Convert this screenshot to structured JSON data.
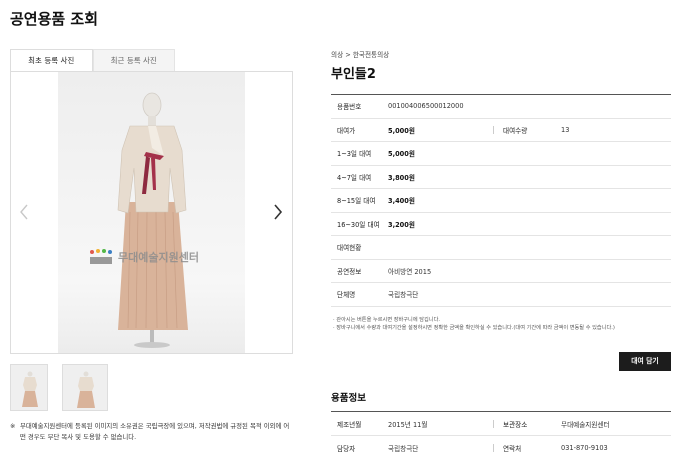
{
  "page": {
    "title": "공연용품 조회"
  },
  "gallery": {
    "tabs": [
      {
        "label": "최초 등록 사진"
      },
      {
        "label": "최근 등록 사진"
      }
    ],
    "watermark": "무대예술지원센터",
    "copyright": "무대예술지원센터에 등록된 이미지의 소유권은 국립극장에 있으며, 저작권법에 규정된 목적 이외에 어떤 경우도 무단 복사 및 도용할 수 없습니다.",
    "copyright_mark": "※",
    "colors": {
      "jeogori": "#e7dccf",
      "chima": "#d9b39a",
      "goreum": "#a4314a"
    }
  },
  "item": {
    "breadcrumb": "의상 > 한국전통의상",
    "title": "부인들2",
    "product_no_label": "용품번호",
    "product_no": "001004006500012000",
    "rent_price_label": "대여가",
    "rent_price": "5,000원",
    "rent_qty_label": "대여수량",
    "rent_qty": "13",
    "periods": [
      {
        "label": "1~3일 대여",
        "price": "5,000원"
      },
      {
        "label": "4~7일 대여",
        "price": "3,800원"
      },
      {
        "label": "8~15일 대여",
        "price": "3,400원"
      },
      {
        "label": "16~30일 대여",
        "price": "3,200원"
      }
    ],
    "status_label": "대여현황",
    "performance_label": "공연정보",
    "performance": "아비방연 2015",
    "group_label": "단체명",
    "group": "국립창극단",
    "notes": [
      "· 관아시는 버튼을 누르시면 장바구니에 담깁니다.",
      "· 장바구니에서 수량과 대여기간을 설정하시면 정확한 금액을 확인하실 수 있습니다.(대여 기간에 따라 금액이 변동될 수 있습니다.)"
    ],
    "rent_button": "대여 담기"
  },
  "spec": {
    "title": "용품정보",
    "rows": [
      {
        "k1": "제조년월",
        "v1": "2015년 11월",
        "k2": "보관장소",
        "v2": "무대예술지원센터"
      },
      {
        "k1": "담당자",
        "v1": "국립창극단",
        "k2": "연락처",
        "v2": "031-870-9103"
      }
    ]
  }
}
